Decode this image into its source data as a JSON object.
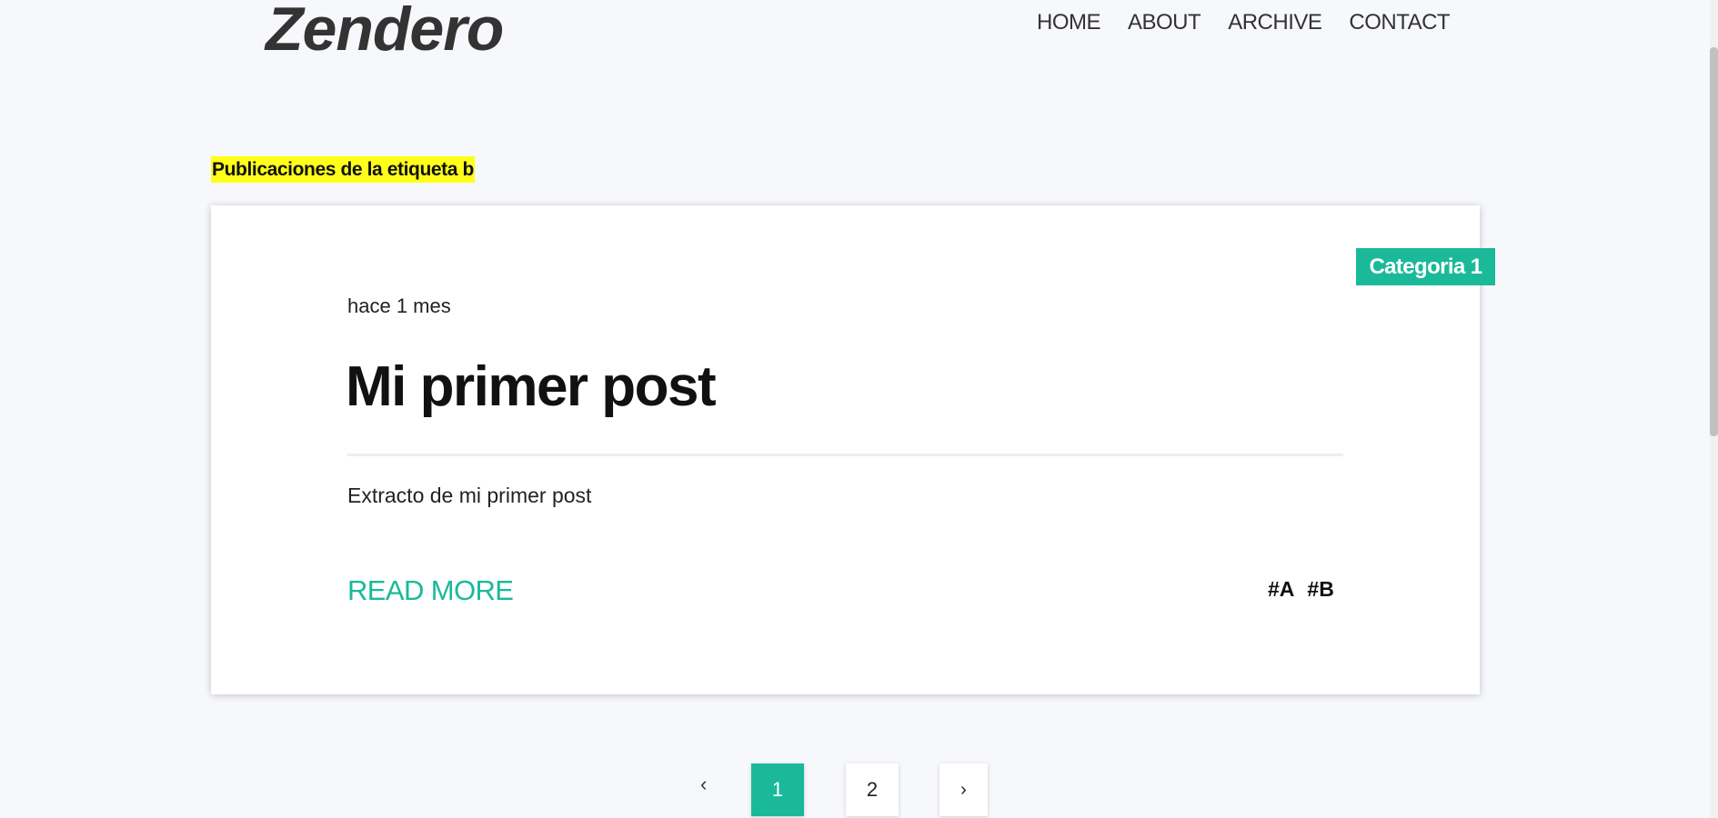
{
  "header": {
    "logo": "Zendero",
    "nav": [
      "HOME",
      "ABOUT",
      "ARCHIVE",
      "CONTACT"
    ]
  },
  "tag_heading": "Publicaciones de la etiqueta b",
  "post": {
    "category": "Categoria 1",
    "date": "hace 1 mes",
    "title": "Mi primer post",
    "excerpt": "Extracto de mi primer post",
    "read_more": "READ MORE",
    "tags": [
      "#A",
      "#B"
    ]
  },
  "pagination": {
    "prev": "‹",
    "pages": [
      "1",
      "2"
    ],
    "current": "1",
    "next": "›"
  },
  "colors": {
    "accent": "#1ab99a",
    "highlight": "#ffff1a",
    "background": "#f7f8fb"
  }
}
